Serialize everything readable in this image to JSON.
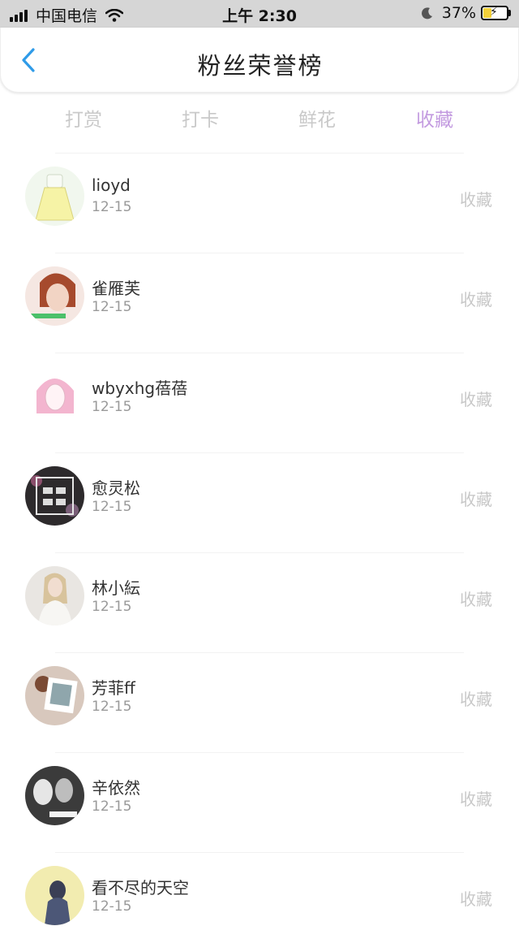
{
  "status_bar": {
    "carrier": "中国电信",
    "time": "上午 2:30",
    "battery": "37%",
    "battery_level": 0.37,
    "icons": [
      "signal-icon",
      "wifi-icon",
      "moon-icon",
      "battery-icon"
    ]
  },
  "header": {
    "back_icon": "chevron-left-icon",
    "title": "粉丝荣誉榜"
  },
  "tabs": [
    {
      "label": "打赏"
    },
    {
      "label": "打卡"
    },
    {
      "label": "鲜花"
    },
    {
      "label": "收藏"
    }
  ],
  "active_tab": "收藏",
  "colors": {
    "accent": "#c39be0",
    "back_arrow": "#2f9be8",
    "status_bar_bg": "#d6d6d6",
    "inactive_tab": "#c9c9c9"
  },
  "fans": [
    {
      "name": "lioyd",
      "date": "12-15",
      "action": "收藏",
      "avatar": "avatar-illustrated-dress"
    },
    {
      "name": "雀雁芙",
      "date": "12-15",
      "action": "收藏",
      "avatar": "avatar-girl-photo"
    },
    {
      "name": "wbyxhg蓓蓓",
      "date": "12-15",
      "action": "收藏",
      "avatar": "avatar-pink-sketch"
    },
    {
      "name": "愈灵松",
      "date": "12-15",
      "action": "收藏",
      "avatar": "avatar-dark-text-art"
    },
    {
      "name": "林小紜",
      "date": "12-15",
      "action": "收藏",
      "avatar": "avatar-blonde-woman"
    },
    {
      "name": "芳菲ff",
      "date": "12-15",
      "action": "收藏",
      "avatar": "avatar-photo-frame"
    },
    {
      "name": "辛依然",
      "date": "12-15",
      "action": "收藏",
      "avatar": "avatar-monochrome-couple"
    },
    {
      "name": "看不尽的天空",
      "date": "12-15",
      "action": "收藏",
      "avatar": "avatar-yellow-figure"
    }
  ]
}
